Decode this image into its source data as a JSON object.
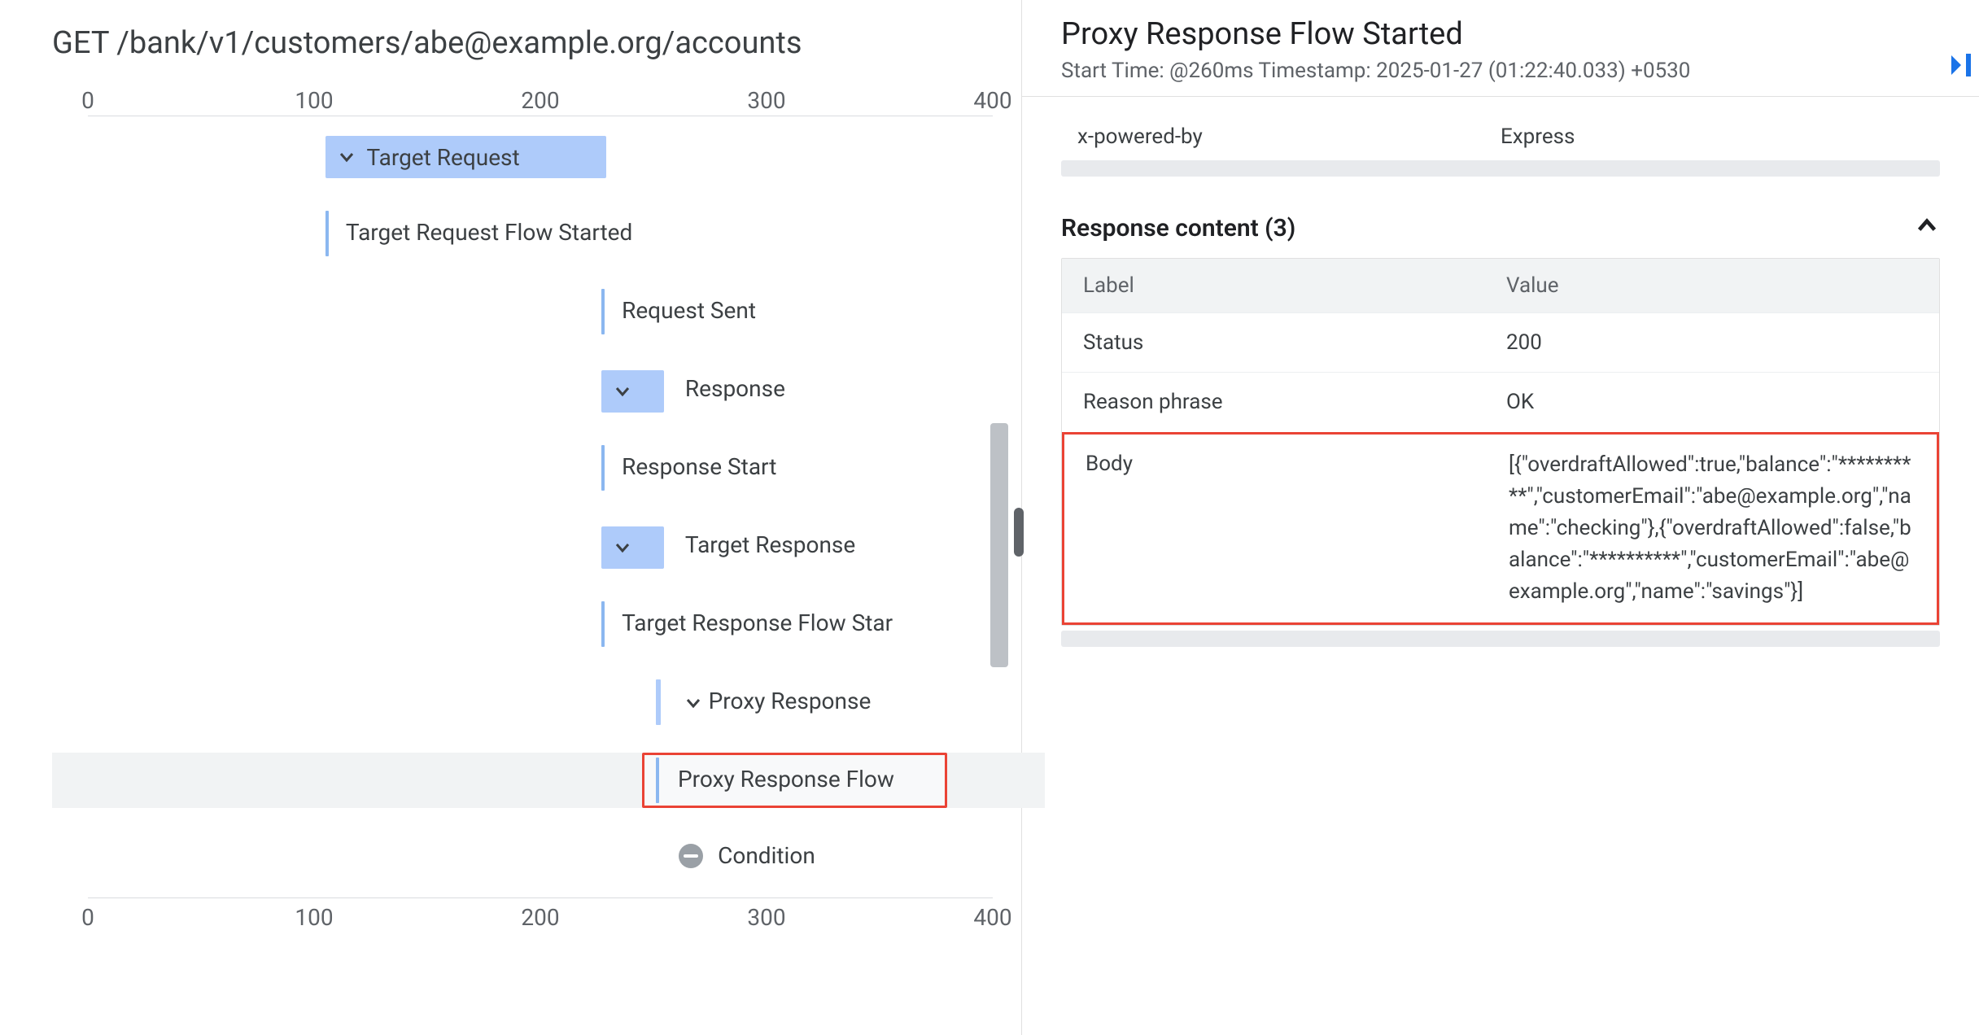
{
  "left": {
    "method": "GET",
    "path": "/bank/v1/customers/abe@example.org/accounts",
    "axis_ticks": [
      "0",
      "100",
      "200",
      "300",
      "400"
    ],
    "rows": [
      {
        "type": "bar",
        "label": "Target Request",
        "chevron": true,
        "start_pct": 26.3,
        "end_pct": 40.0
      },
      {
        "type": "event",
        "label": "Target Request Flow Started",
        "chevron": false,
        "start_pct": 26.3
      },
      {
        "type": "event",
        "label": "Request Sent",
        "chevron": false,
        "start_pct": 56.7
      },
      {
        "type": "bar",
        "label": "Response",
        "chevron": true,
        "start_pct": 56.7,
        "end_pct": 63.0
      },
      {
        "type": "event",
        "label": "Response Start",
        "chevron": false,
        "start_pct": 56.7
      },
      {
        "type": "bar",
        "label": "Target Response",
        "chevron": true,
        "start_pct": 56.7,
        "end_pct": 63.0
      },
      {
        "type": "event",
        "label": "Target Response Flow Star",
        "chevron": false,
        "start_pct": 56.7
      },
      {
        "type": "chev",
        "label": "Proxy Response",
        "chevron": true,
        "start_pct": 62.8
      },
      {
        "type": "event",
        "label": "Proxy Response Flow",
        "chevron": false,
        "start_pct": 62.8,
        "selected": true
      },
      {
        "type": "minus",
        "label": "Condition",
        "chevron": false,
        "start_pct": 65.3
      }
    ]
  },
  "right": {
    "title": "Proxy Response Flow Started",
    "subtitle": "Start Time: @260ms Timestamp: 2025-01-27 (01:22:40.033) +0530",
    "header_kv": {
      "key": "x-powered-by",
      "value": "Express"
    },
    "section_title": "Response content (3)",
    "table_headers": {
      "label": "Label",
      "value": "Value"
    },
    "rows": [
      {
        "label": "Status",
        "value": "200"
      },
      {
        "label": "Reason phrase",
        "value": "OK"
      },
      {
        "label": "Body",
        "value": "[{\"overdraftAllowed\":true,\"balance\":\"**********\",\"customerEmail\":\"abe@example.org\",\"name\":\"checking\"},{\"overdraftAllowed\":false,\"balance\":\"**********\",\"customerEmail\":\"abe@example.org\",\"name\":\"savings\"}]"
      }
    ]
  }
}
